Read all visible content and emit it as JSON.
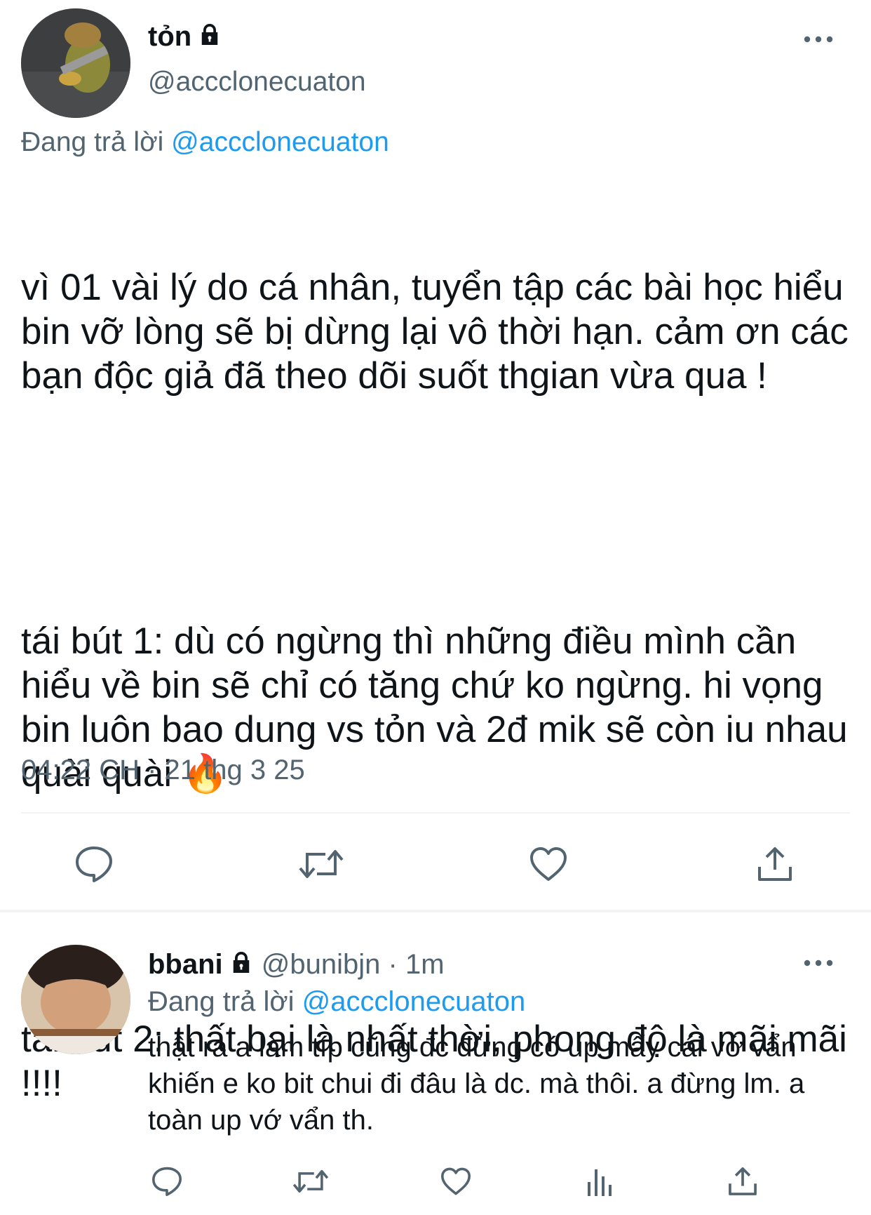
{
  "main_tweet": {
    "display_name": "tỏn",
    "handle": "@accclonecuaton",
    "replying_prefix": "Đang trả lời",
    "replying_to": "@accclonecuaton",
    "paragraphs": [
      "vì 01 vài lý do cá nhân, tuyển tập các bài học hiểu bin vỡ lòng sẽ bị dừng lại vô thời hạn. cảm ơn các bạn độc giả đã theo dõi suốt thgian vừa qua !",
      "tái bút 1: dù có ngừng thì những điều mình cần hiểu về bin sẽ chỉ có tăng chứ ko ngừng. hi vọng bin luôn bao dung vs tỏn và 2đ mik sẽ còn iu nhau quài quài 🔥",
      "tái bút 2: thất bại là nhất thời, phong độ là mãi mãi !!!!"
    ],
    "timestamp": "04:22 CH · 21 thg 3 25"
  },
  "reply_tweet": {
    "display_name": "bbani",
    "handle": "@bunibjn",
    "time": "· 1m",
    "replying_prefix": "Đang trả lời",
    "replying_to": "@accclonecuaton",
    "text": "thật ra a làm típ cũng đc đừng có up mấy cái vớ vẩn khiến e ko bit chui đi đâu là dc. mà thôi. a đừng lm. a toàn up vớ vẩn th."
  },
  "colors": {
    "text": "#0f1419",
    "secondary": "#536471",
    "accent": "#1d9bf0",
    "divider": "#eff3f4"
  },
  "icons": [
    "lock-icon",
    "more-icon",
    "reply-icon",
    "retweet-icon",
    "like-icon",
    "share-icon",
    "views-icon"
  ]
}
